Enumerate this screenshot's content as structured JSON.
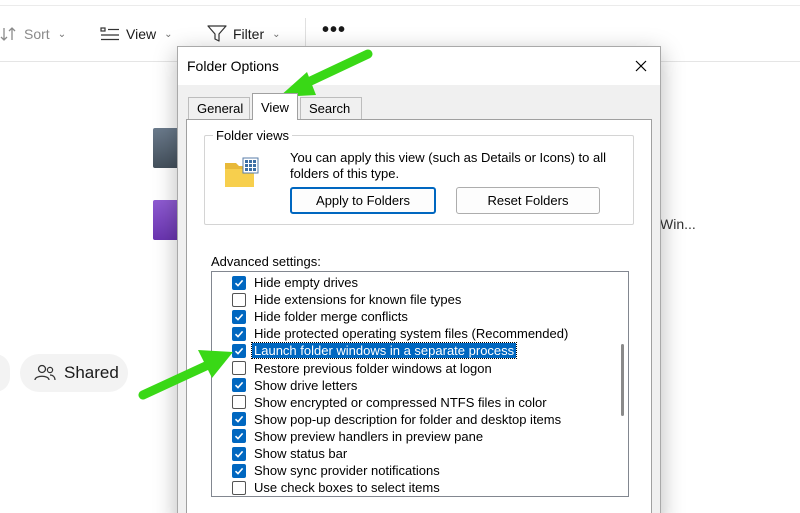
{
  "toolbar": {
    "sort_label": "Sort",
    "view_label": "View",
    "filter_label": "Filter",
    "more_label": "•••"
  },
  "background": {
    "truncated_text": "Win...",
    "shared_label": "Shared"
  },
  "dialog": {
    "title": "Folder Options",
    "tabs": [
      {
        "label": "General",
        "selected": false
      },
      {
        "label": "View",
        "selected": true
      },
      {
        "label": "Search",
        "selected": false
      }
    ],
    "folder_views": {
      "legend": "Folder views",
      "description": "You can apply this view (such as Details or Icons) to all folders of this type.",
      "apply_button": "Apply to Folders",
      "reset_button": "Reset Folders"
    },
    "advanced_label": "Advanced settings:",
    "settings": [
      {
        "label": "Hide empty drives",
        "checked": true
      },
      {
        "label": "Hide extensions for known file types",
        "checked": false
      },
      {
        "label": "Hide folder merge conflicts",
        "checked": true
      },
      {
        "label": "Hide protected operating system files (Recommended)",
        "checked": true
      },
      {
        "label": "Launch folder windows in a separate process",
        "checked": true,
        "selected": true
      },
      {
        "label": "Restore previous folder windows at logon",
        "checked": false
      },
      {
        "label": "Show drive letters",
        "checked": true
      },
      {
        "label": "Show encrypted or compressed NTFS files in color",
        "checked": false
      },
      {
        "label": "Show pop-up description for folder and desktop items",
        "checked": true
      },
      {
        "label": "Show preview handlers in preview pane",
        "checked": true
      },
      {
        "label": "Show status bar",
        "checked": true
      },
      {
        "label": "Show sync provider notifications",
        "checked": true
      },
      {
        "label": "Use check boxes to select items",
        "checked": false
      }
    ]
  },
  "colors": {
    "accent": "#0067c0",
    "annotation_arrow": "#3ee01e"
  }
}
